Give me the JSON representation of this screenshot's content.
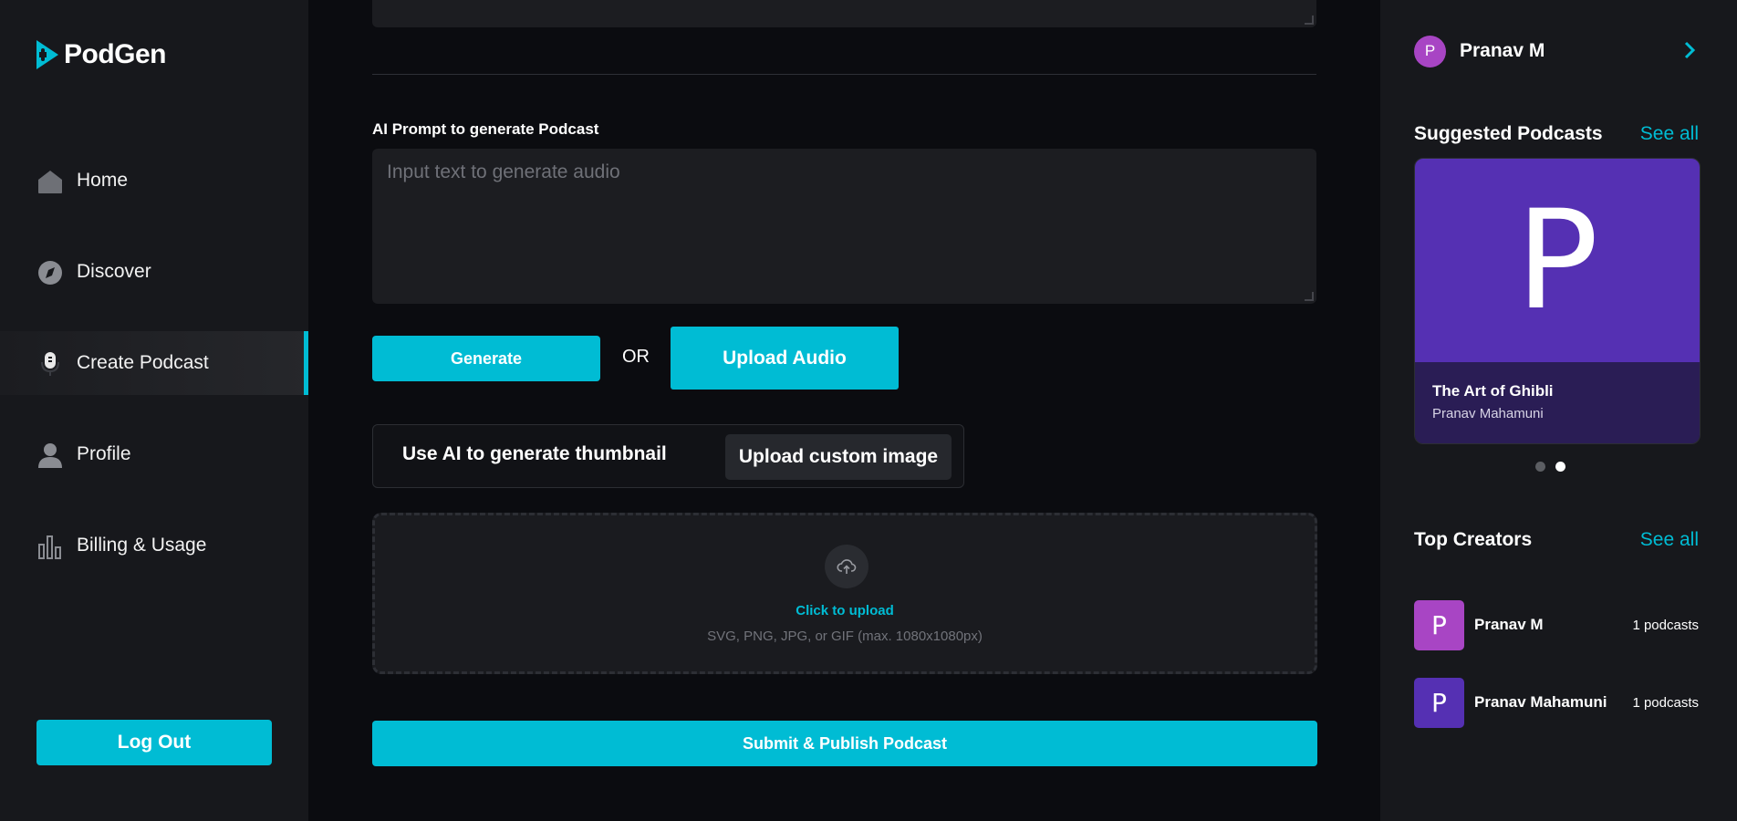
{
  "brand": {
    "name": "PodGen",
    "accent": "#00bcd4"
  },
  "sidebar": {
    "items": [
      {
        "label": "Home",
        "icon": "home-icon"
      },
      {
        "label": "Discover",
        "icon": "compass-icon"
      },
      {
        "label": "Create Podcast",
        "icon": "microphone-icon",
        "active": true
      },
      {
        "label": "Profile",
        "icon": "user-icon"
      },
      {
        "label": "Billing & Usage",
        "icon": "bar-chart-icon"
      }
    ],
    "logout_label": "Log Out"
  },
  "main": {
    "prompt_label": "AI Prompt to generate Podcast",
    "prompt_placeholder": "Input text to generate audio",
    "generate_label": "Generate",
    "or_label": "OR",
    "upload_audio_label": "Upload Audio",
    "thumbnail_ai_label": "Use AI to generate thumbnail",
    "thumbnail_custom_label": "Upload custom image",
    "dropzone": {
      "click_label": "Click to upload",
      "hint": "SVG, PNG, JPG, or GIF (max. 1080x1080px)",
      "icon": "cloud-upload-icon"
    },
    "submit_label": "Submit & Publish Podcast"
  },
  "right": {
    "user": {
      "name": "Pranav M",
      "initial": "P"
    },
    "suggested": {
      "title": "Suggested Podcasts",
      "see_all": "See all",
      "card": {
        "art_letter": "P",
        "title": "The Art of Ghibli",
        "author": "Pranav Mahamuni"
      },
      "active_dot": 2
    },
    "top_creators": {
      "title": "Top Creators",
      "see_all": "See all",
      "items": [
        {
          "initial": "P",
          "name": "Pranav M",
          "count": "1 podcasts",
          "color": "#a845c4"
        },
        {
          "initial": "P",
          "name": "Pranav Mahamuni",
          "count": "1 podcasts",
          "color": "#5530b3"
        }
      ]
    }
  }
}
